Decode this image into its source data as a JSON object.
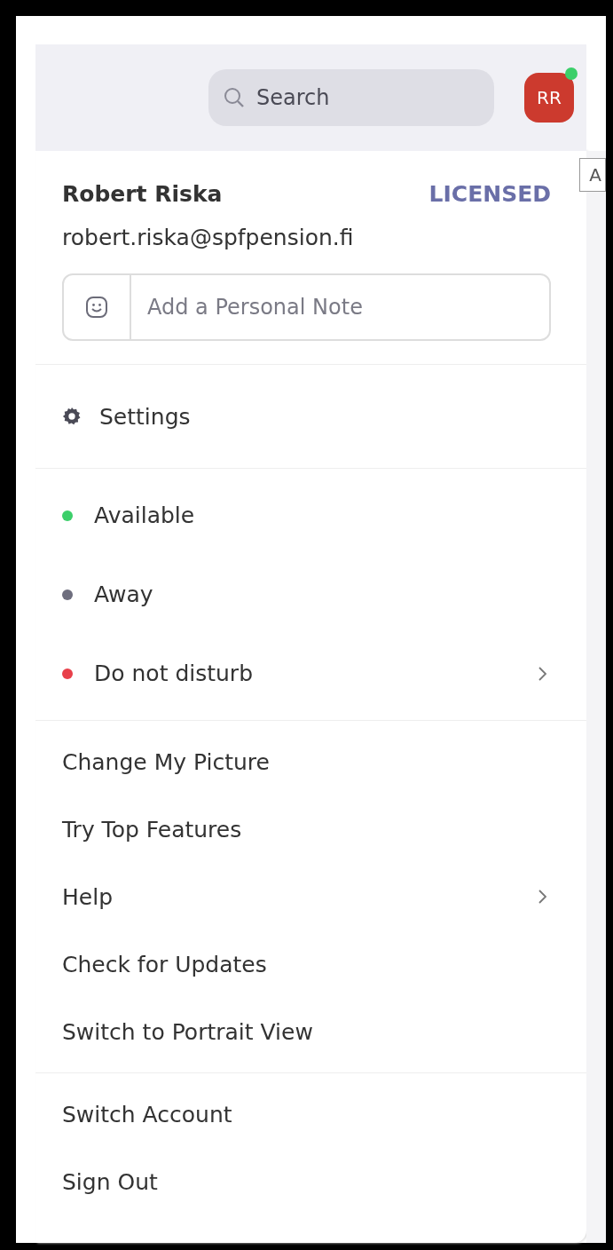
{
  "header": {
    "search": {
      "placeholder": "Search"
    },
    "avatar": {
      "initials": "RR",
      "online": true
    },
    "tooltip": "A"
  },
  "profile": {
    "name": "Robert Riska",
    "license": "LICENSED",
    "email": "robert.riska@spfpension.fi",
    "note": {
      "placeholder": "Add a Personal Note"
    }
  },
  "sections": [
    {
      "items": [
        {
          "kind": "settings",
          "label": "Settings",
          "submenu": false
        }
      ]
    },
    {
      "items": [
        {
          "kind": "status",
          "label": "Available",
          "color": "#3ccf6a",
          "submenu": false
        },
        {
          "kind": "status",
          "label": "Away",
          "color": "#6e6e7e",
          "submenu": false
        },
        {
          "kind": "status",
          "label": "Do not disturb",
          "color": "#e8404a",
          "submenu": true
        }
      ]
    },
    {
      "items": [
        {
          "kind": "plain",
          "label": "Change My Picture",
          "submenu": false
        },
        {
          "kind": "plain",
          "label": "Try Top Features",
          "submenu": false
        },
        {
          "kind": "plain",
          "label": "Help",
          "submenu": true
        },
        {
          "kind": "plain",
          "label": "Check for Updates",
          "submenu": false
        },
        {
          "kind": "plain",
          "label": "Switch to Portrait View",
          "submenu": false
        }
      ]
    },
    {
      "items": [
        {
          "kind": "plain",
          "label": "Switch Account",
          "submenu": false
        },
        {
          "kind": "plain",
          "label": "Sign Out",
          "submenu": false
        }
      ]
    }
  ]
}
